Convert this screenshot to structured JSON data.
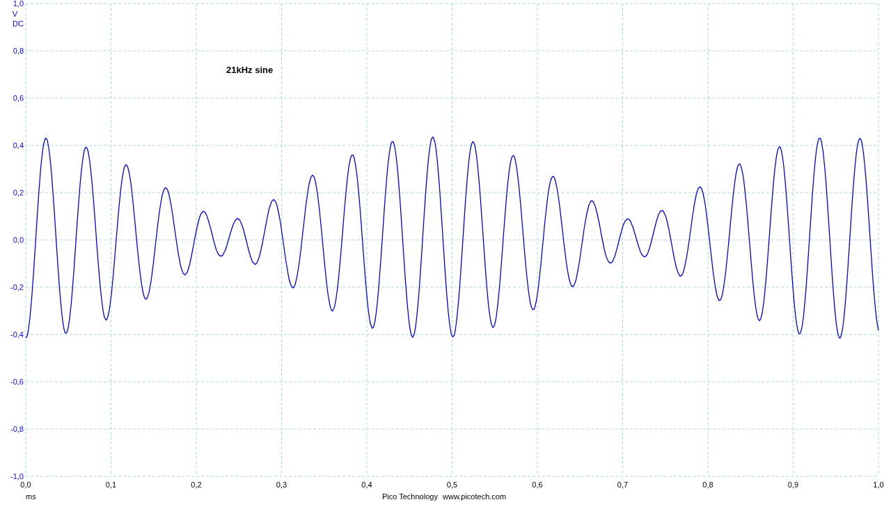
{
  "chart": {
    "annotation": "21kHz sine",
    "y_unit": "V",
    "coupling": "DC",
    "x_unit": "ms",
    "y_ticks": [
      "1,0",
      "0,8",
      "0,6",
      "0,4",
      "0,2",
      "0,0",
      "-0,2",
      "-0,4",
      "-0,6",
      "-0,8",
      "-1,0"
    ],
    "x_ticks": [
      "0,0",
      "0,1",
      "0,2",
      "0,3",
      "0,4",
      "0,5",
      "0,6",
      "0,7",
      "0,8",
      "0,9",
      "1,0"
    ]
  },
  "footer": {
    "company": "Pico Technology",
    "website": "www.picotech.com"
  }
}
